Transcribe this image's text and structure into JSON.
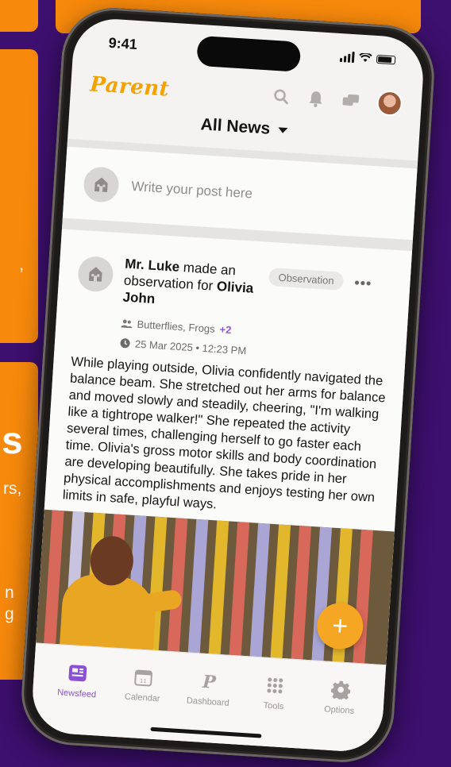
{
  "background": {
    "heading_fragment": "s",
    "line1": "rs,",
    "line2": "n",
    "line3": "g",
    "side_fragment": ","
  },
  "status_bar": {
    "time": "9:41"
  },
  "header": {
    "logo": "Parent"
  },
  "feed": {
    "selector_label": "All News"
  },
  "composer": {
    "placeholder": "Write your post here"
  },
  "post": {
    "author_name": "Mr. Luke",
    "action_text": "made an observation for",
    "child_name": "Olivia John",
    "tag": "Observation",
    "groups": "Butterflies, Frogs",
    "groups_more": "+2",
    "timestamp": "25 Mar 2025 • 12:23 PM",
    "body": "While playing outside, Olivia confidently navigated the balance beam. She stretched out her arms for balance and moved slowly and steadily, cheering, \"I'm walking like a tightrope walker!\" She repeated the activity several times, challenging herself to go faster each time. Olivia's gross motor skills and body coordination are developing beautifully. She takes pride in her physical accomplishments and enjoys testing her own limits in safe, playful ways."
  },
  "fab": {
    "label": "+"
  },
  "tabs": [
    {
      "label": "Newsfeed",
      "active": true
    },
    {
      "label": "Calendar",
      "active": false
    },
    {
      "label": "Dashboard",
      "active": false
    },
    {
      "label": "Tools",
      "active": false
    },
    {
      "label": "Options",
      "active": false
    }
  ],
  "colors": {
    "background": "#3d0f6e",
    "card": "#f7890c",
    "brand": "#f5a200",
    "accent": "#8b4fd6",
    "fab": "#f5a623"
  }
}
